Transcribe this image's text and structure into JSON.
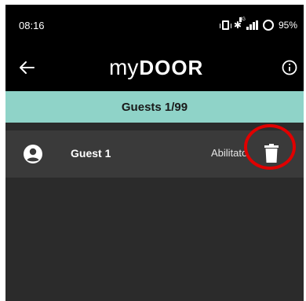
{
  "status_bar": {
    "time": "08:16",
    "network": "4G",
    "battery": "95%"
  },
  "app_bar": {
    "logo_my": "my",
    "logo_door": "DOOR",
    "back_icon": "arrow-left-icon",
    "info_icon": "info-circle-icon"
  },
  "header": {
    "title": "Guests 1/99"
  },
  "guests": [
    {
      "name": "Guest 1",
      "status": "Abilitato",
      "avatar_icon": "account-circle-icon",
      "action_icon": "trash-icon"
    }
  ],
  "colors": {
    "header_bg": "#8fd3c8",
    "row_bg": "#3a3a3a",
    "highlight": "#e00000"
  }
}
